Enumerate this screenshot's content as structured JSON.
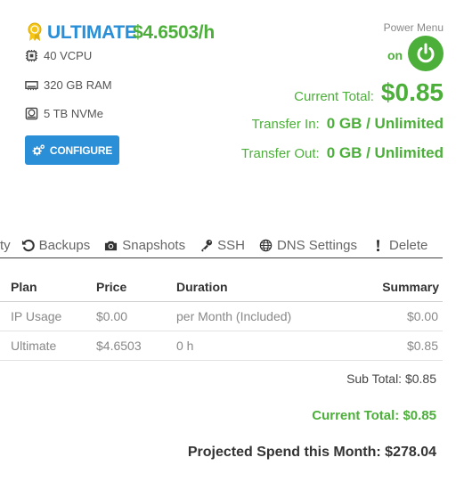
{
  "plan": {
    "name": "ULTIMATE",
    "rate": "$4.6503/h",
    "specs": [
      {
        "icon": "cpu-icon",
        "value": "40",
        "unit": "VCPU"
      },
      {
        "icon": "ram-icon",
        "value": "320 GB",
        "unit": "RAM"
      },
      {
        "icon": "disk-icon",
        "value": "5 TB",
        "unit": "NVMe"
      }
    ],
    "configure_label": "CONFIGURE"
  },
  "power": {
    "label": "Power Menu",
    "state": "on"
  },
  "totals": {
    "current_label": "Current Total:",
    "current_value": "$0.85",
    "transfer_in_label": "Transfer In:",
    "transfer_in_value": "0 GB / Unlimited",
    "transfer_out_label": "Transfer Out:",
    "transfer_out_value": "0 GB / Unlimited"
  },
  "tabs": [
    {
      "label": "ty",
      "icon": ""
    },
    {
      "label": "Backups",
      "icon": "restore-icon"
    },
    {
      "label": "Snapshots",
      "icon": "camera-icon"
    },
    {
      "label": "SSH",
      "icon": "key-icon"
    },
    {
      "label": "DNS Settings",
      "icon": "globe-icon"
    },
    {
      "label": "Delete",
      "icon": "exclamation-icon"
    }
  ],
  "table": {
    "headers": [
      "Plan",
      "Price",
      "Duration",
      "Summary"
    ],
    "rows": [
      [
        "IP Usage",
        "$0.00",
        "per Month (Included)",
        "$0.00"
      ],
      [
        "Ultimate",
        "$4.6503",
        "0 h",
        "$0.85"
      ]
    ]
  },
  "summary": {
    "sub_total": "Sub Total: $0.85",
    "current_total": "Current Total: $0.85",
    "projected": "Projected Spend this Month: $278.04"
  },
  "colors": {
    "brand_blue": "#2a8fd6",
    "accent_green": "#4caf3a"
  }
}
